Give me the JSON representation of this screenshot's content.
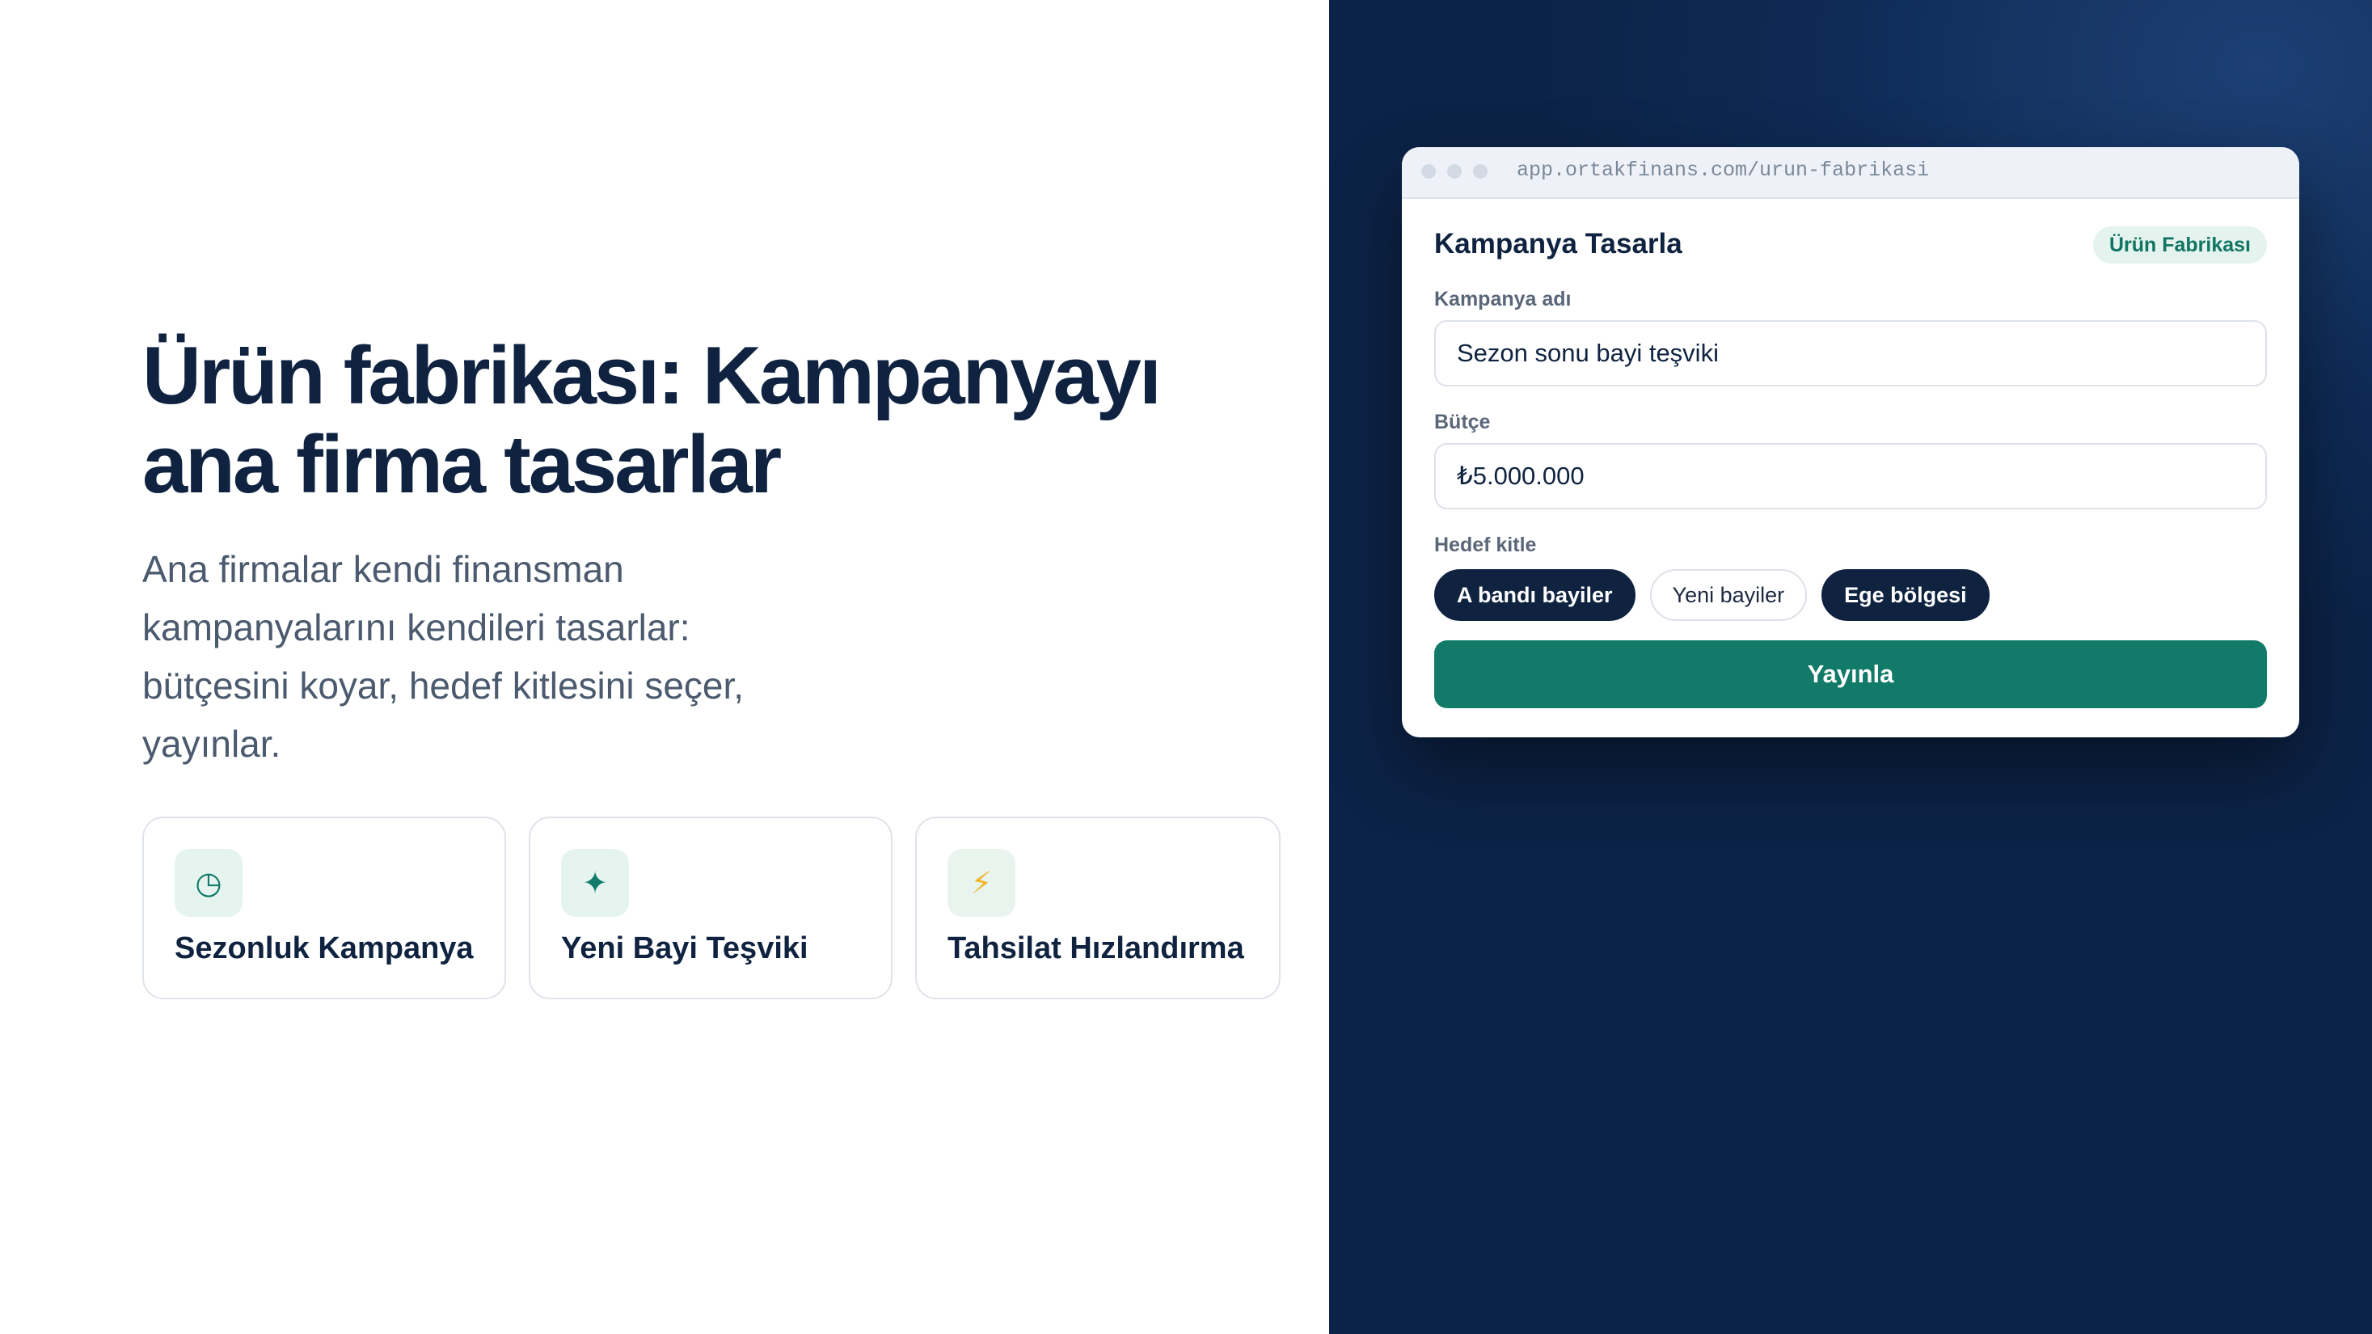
{
  "hero": {
    "title": "Ürün fabrikası: Kampanyayı ana firma tasarlar",
    "lead": "Ana firmalar kendi finansman kampanyalarını kendileri tasarlar: bütçesini koyar, hedef kitlesini seçer, yayınlar."
  },
  "cards": [
    {
      "icon": "◷",
      "icon_name": "clock-icon",
      "title": "Sezonluk Kampanya"
    },
    {
      "icon": "✦",
      "icon_name": "sparkle-icon",
      "title": "Yeni Bayi Teşviki"
    },
    {
      "icon": "⚡",
      "icon_name": "bolt-icon",
      "title": "Tahsilat Hızlandırma"
    }
  ],
  "browser": {
    "url": "app.ortakfinans.com/urun-fabrikasi"
  },
  "form": {
    "title": "Kampanya Tasarla",
    "badge": "Ürün Fabrikası",
    "name_label": "Kampanya adı",
    "name_value": "Sezon sonu bayi teşviki",
    "budget_label": "Bütçe",
    "budget_value": "₺5.000.000",
    "audience_label": "Hedef kitle",
    "audience_chips": [
      {
        "label": "A bandı bayiler",
        "selected": true
      },
      {
        "label": "Yeni bayiler",
        "selected": false
      },
      {
        "label": "Ege bölgesi",
        "selected": true
      }
    ],
    "publish_label": "Yayınla"
  },
  "colors": {
    "navy": "#0f2340",
    "accent_green": "#117a68",
    "panel_bg": "#0e2a55"
  }
}
